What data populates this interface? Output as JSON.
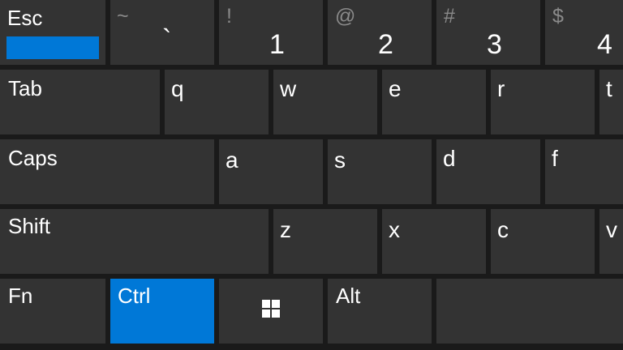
{
  "keyboard": {
    "colors": {
      "background": "#1a1a1a",
      "key": "#333333",
      "active_key": "#0078d7",
      "text": "#ffffff",
      "shift_text": "#8a8a8a"
    },
    "row1": {
      "esc": "Esc",
      "backtick": {
        "shift": "~",
        "main": "`"
      },
      "k1": {
        "shift": "!",
        "main": "1"
      },
      "k2": {
        "shift": "@",
        "main": "2"
      },
      "k3": {
        "shift": "#",
        "main": "3"
      },
      "k4": {
        "shift": "$",
        "main": "4"
      }
    },
    "row2": [
      "Tab",
      "q",
      "w",
      "e",
      "r",
      "t"
    ],
    "row3": [
      "Caps",
      "a",
      "s",
      "d",
      "f"
    ],
    "row4": [
      "Shift",
      "z",
      "x",
      "c",
      "v"
    ],
    "row5": {
      "fn": "Fn",
      "ctrl": "Ctrl",
      "win_icon": "windows-logo",
      "alt": "Alt",
      "space": ""
    },
    "active_keys": [
      "Esc",
      "Ctrl"
    ]
  }
}
